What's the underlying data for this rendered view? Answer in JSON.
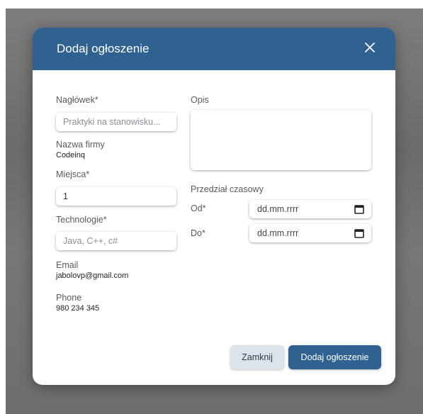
{
  "modal": {
    "title": "Dodaj ogłoszenie",
    "close_icon": "close-icon",
    "header_color": "#2f6290"
  },
  "form": {
    "headline": {
      "label": "Nagłówek*",
      "placeholder": "Praktyki na stanowisku..."
    },
    "company": {
      "label": "Nazwa firmy",
      "value": "Codeinq"
    },
    "seats": {
      "label": "Miejsca*",
      "value": "1"
    },
    "technologies": {
      "label": "Technologie*",
      "placeholder": "Java, C++, c#"
    },
    "email": {
      "label": "Email",
      "value": "jabolovp@gmail.com"
    },
    "phone": {
      "label": "Phone",
      "value": "980 234 345"
    },
    "description": {
      "label": "Opis",
      "value": ""
    },
    "period": {
      "label": "Przedział czasowy",
      "from": {
        "label": "Od*",
        "value": "dd.mm.rrrr",
        "icon": "calendar-icon"
      },
      "to": {
        "label": "Do*",
        "value": "dd.mm.rrrr",
        "icon": "calendar-icon"
      }
    }
  },
  "actions": {
    "close_label": "Zamknij",
    "submit_label": "Dodaj ogłoszenie"
  }
}
